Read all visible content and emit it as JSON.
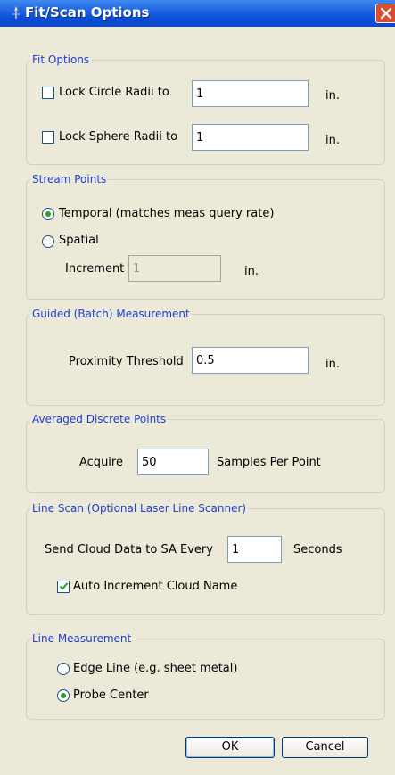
{
  "window": {
    "title": "Fit/Scan Options"
  },
  "fit_options": {
    "legend": "Fit Options",
    "lock_circle": {
      "label": "Lock Circle Radii to",
      "checked": false,
      "value": "1",
      "unit": "in."
    },
    "lock_sphere": {
      "label": "Lock Sphere Radii to",
      "checked": false,
      "value": "1",
      "unit": "in."
    }
  },
  "stream_points": {
    "legend": "Stream Points",
    "temporal_label": "Temporal (matches meas query rate)",
    "spatial_label": "Spatial",
    "selected": "temporal",
    "increment_label": "Increment",
    "increment_value": "1",
    "increment_unit": "in."
  },
  "guided": {
    "legend": "Guided (Batch) Measurement",
    "proximity_label": "Proximity Threshold",
    "proximity_value": "0.5",
    "proximity_unit": "in."
  },
  "averaged": {
    "legend": "Averaged Discrete Points",
    "acquire_label": "Acquire",
    "acquire_value": "50",
    "samples_label": "Samples Per Point"
  },
  "line_scan": {
    "legend": "Line Scan (Optional Laser Line Scanner)",
    "send_label": "Send Cloud Data to SA Every",
    "send_value": "1",
    "seconds_label": "Seconds",
    "auto_increment_label": "Auto Increment Cloud Name",
    "auto_increment_checked": true
  },
  "line_measurement": {
    "legend": "Line Measurement",
    "edge_label": "Edge Line (e.g. sheet metal)",
    "probe_label": "Probe Center",
    "selected": "probe"
  },
  "buttons": {
    "ok": "OK",
    "cancel": "Cancel"
  },
  "colors": {
    "titlebar": "#0a4ed6",
    "face": "#ECE9D8",
    "legend_text": "#1f3fd0",
    "radio_dot": "#21a121"
  }
}
